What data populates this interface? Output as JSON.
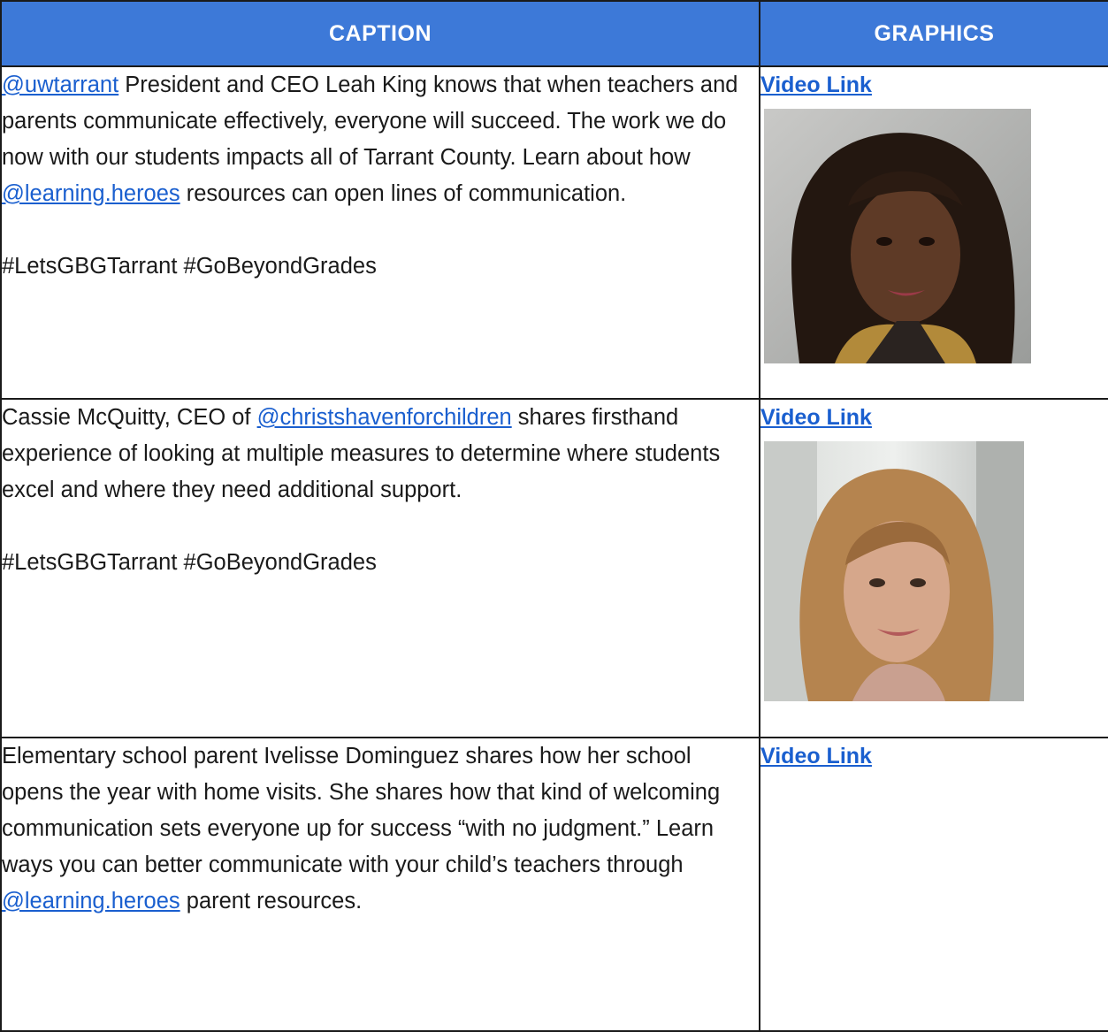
{
  "table": {
    "headers": {
      "caption": "CAPTION",
      "graphics": "GRAPHICS"
    },
    "rows": [
      {
        "caption_parts": {
          "mention1": "@uwtarrant",
          "text1": " President and CEO Leah King knows that when teachers and parents communicate effectively, everyone will succeed. The work we do now with our students impacts all of Tarrant County. Learn about how ",
          "mention2": "@learning.heroes",
          "text2": " resources can open lines of communication."
        },
        "hashtags": "#LetsGBGTarrant #GoBeyondGrades",
        "video_link": "Video Link",
        "thumbnail": "woman-dark-hair-portrait"
      },
      {
        "caption_parts": {
          "text1": "Cassie McQuitty, CEO of ",
          "mention1": "@christshavenforchildren",
          "text2": " shares firsthand experience of looking at multiple measures to determine where students excel and where they need additional support."
        },
        "hashtags": "#LetsGBGTarrant #GoBeyondGrades",
        "video_link": "Video Link",
        "thumbnail": "woman-blonde-hair-portrait"
      },
      {
        "caption_parts": {
          "text1": "Elementary school parent Ivelisse Dominguez shares how her school opens the year with home visits. She shares how that kind of welcoming communication sets everyone up for success “with no judgment.” Learn ways you can better communicate with your child’s teachers through ",
          "mention1": "@learning.heroes",
          "text2": " parent resources."
        },
        "video_link": "Video Link"
      }
    ]
  }
}
